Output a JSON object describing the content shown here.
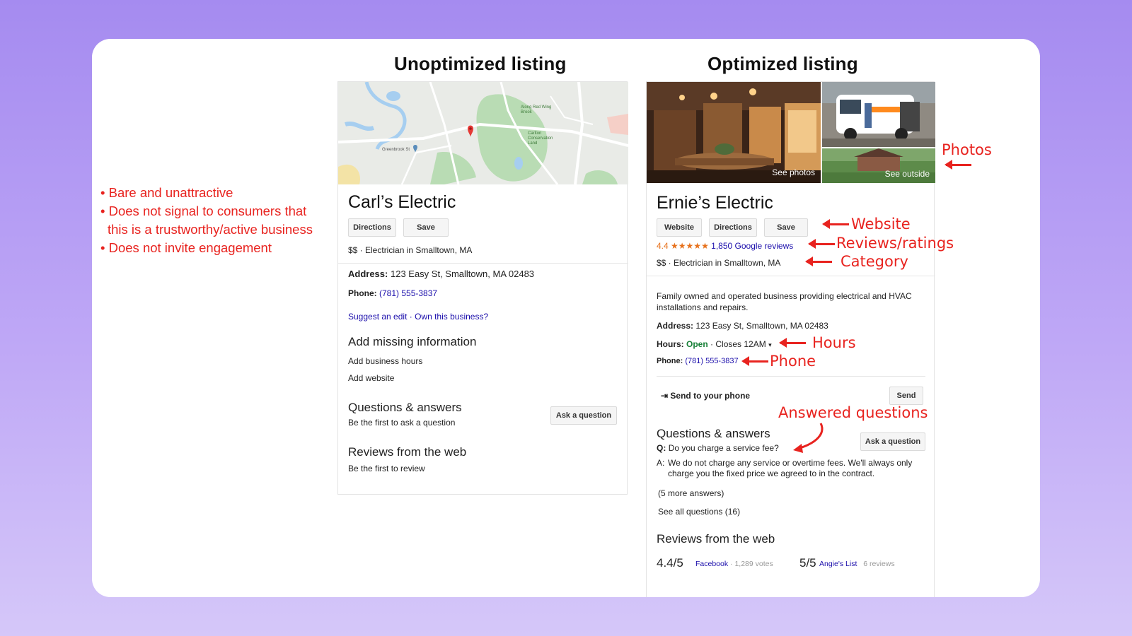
{
  "headings": {
    "left": "Unoptimized listing",
    "right": "Optimized listing"
  },
  "bullets": [
    "• Bare and unattractive",
    "• Does not signal to consumers that",
    "this is a trustworthy/active business",
    "• Does not invite engagement"
  ],
  "unoptimized": {
    "business_name": "Carl’s Electric",
    "buttons": {
      "directions": "Directions",
      "save": "Save"
    },
    "meta": "$$ · Electrician in Smalltown, MA",
    "address_label": "Address:",
    "address": "123 Easy St, Smalltown, MA 02483",
    "phone_label": "Phone:",
    "phone": "(781) 555-3837",
    "suggest_edit": "Suggest an edit",
    "own_business": "Own this business?",
    "missing_title": "Add missing information",
    "add_hours": "Add business hours",
    "add_website": "Add website",
    "qa_title": "Questions & answers",
    "qa_first": "Be the first to ask a question",
    "ask_button": "Ask a question",
    "reviews_title": "Reviews from the web",
    "reviews_first": "Be the first to review",
    "map_labels": {
      "park1": "Along Red Wing Brook",
      "park2": "Carlton Conservation Land",
      "place": "Greenbrook St"
    }
  },
  "optimized": {
    "see_photos": "See photos",
    "see_outside": "See outside",
    "business_name": "Ernie’s Electric",
    "buttons": {
      "website": "Website",
      "directions": "Directions",
      "save": "Save"
    },
    "rating_value": "4.4",
    "stars": "★★★★★",
    "reviews_link": "1,850 Google reviews",
    "meta": "$$ · Electrician in Smalltown, MA",
    "description": "Family owned and operated business providing electrical and HVAC installations and repairs.",
    "address_label": "Address:",
    "address": "123 Easy St, Smalltown, MA 02483",
    "hours_label": "Hours:",
    "hours_open": "Open",
    "hours_close": "· Closes 12AM",
    "phone_label": "Phone:",
    "phone": "(781) 555-3837",
    "send_to_phone": "Send to your phone",
    "send_button": "Send",
    "qa_title": "Questions & answers",
    "ask_button": "Ask a question",
    "q_label": "Q:",
    "question": "Do you charge a service fee?",
    "a_label": "A:",
    "answer": "We do not charge any service or overtime fees. We'll always only charge you the fixed price we agreed to in the contract.",
    "more_answers": "(5 more answers)",
    "see_all": "See all questions (16)",
    "reviews_title": "Reviews from the web",
    "review1_score": "4.4/5",
    "review1_source": "Facebook",
    "review1_votes": "· 1,289 votes",
    "review2_score": "5/5",
    "review2_source": "Angie's List",
    "review2_count": "6 reviews"
  },
  "annotations": {
    "photos": "Photos",
    "website": "Website",
    "reviews": "Reviews/ratings",
    "category": "Category",
    "hours": "Hours",
    "phone": "Phone",
    "answered": "Answered questions"
  },
  "colors": {
    "accent_red": "#e8231f",
    "link_blue": "#1a0dab",
    "open_green": "#188038",
    "rating_orange": "#e7711b"
  }
}
